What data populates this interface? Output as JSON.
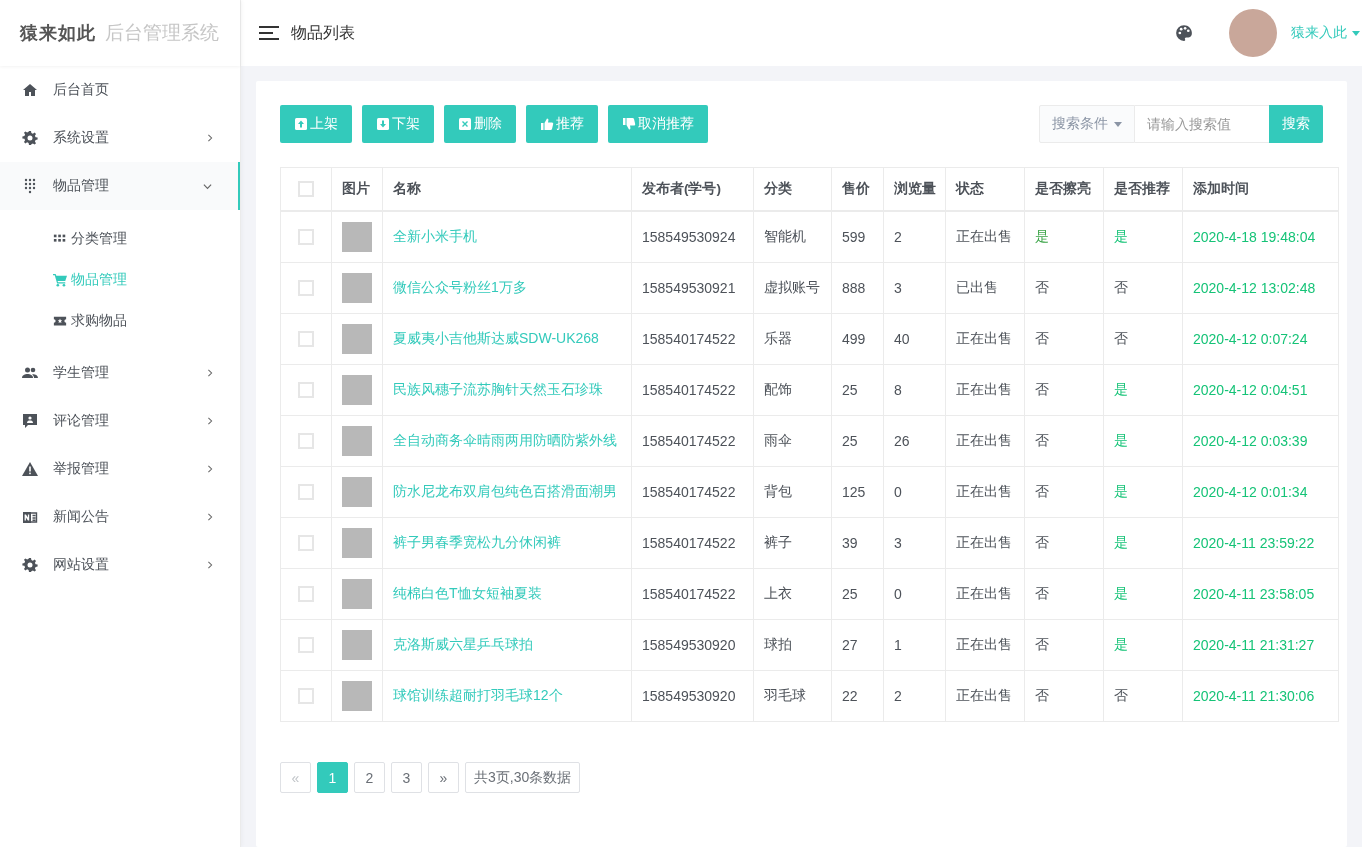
{
  "brand": {
    "logo": "猿来如此",
    "subtitle": "后台管理系统"
  },
  "header": {
    "title": "物品列表",
    "user_name": "猿来入此"
  },
  "sidebar": {
    "items": [
      {
        "label": "后台首页",
        "kind": "link"
      },
      {
        "label": "系统设置",
        "kind": "group",
        "expanded": false
      },
      {
        "label": "物品管理",
        "kind": "group",
        "expanded": true,
        "children": [
          {
            "label": "分类管理",
            "selected": false
          },
          {
            "label": "物品管理",
            "selected": true
          },
          {
            "label": "求购物品",
            "selected": false
          }
        ]
      },
      {
        "label": "学生管理",
        "kind": "group",
        "expanded": false
      },
      {
        "label": "评论管理",
        "kind": "group",
        "expanded": false
      },
      {
        "label": "举报管理",
        "kind": "group",
        "expanded": false
      },
      {
        "label": "新闻公告",
        "kind": "group",
        "expanded": false
      },
      {
        "label": "网站设置",
        "kind": "group",
        "expanded": false
      }
    ]
  },
  "toolbar": {
    "buttons": [
      "上架",
      "下架",
      "删除",
      "推荐",
      "取消推荐"
    ],
    "search": {
      "condition": "搜索条件",
      "placeholder": "请输入搜索值",
      "button": "搜索"
    }
  },
  "table": {
    "select_all": false,
    "columns": [
      "图片",
      "名称",
      "发布者(学号)",
      "分类",
      "售价",
      "浏览量",
      "状态",
      "是否擦亮",
      "是否推荐",
      "添加时间"
    ],
    "rows": [
      {
        "checked": false,
        "name": "全新小米手机",
        "publisher": "158549530924",
        "category": "智能机",
        "price": "599",
        "views": "2",
        "status": "正在出售",
        "sticky": {
          "text": "是",
          "on": true
        },
        "recommended": {
          "text": "是",
          "on": true
        },
        "added": "2020-4-18 19:48:04"
      },
      {
        "checked": false,
        "name": "微信公众号粉丝1万多",
        "publisher": "158549530921",
        "category": "虚拟账号",
        "price": "888",
        "views": "3",
        "status": "已出售",
        "sticky": {
          "text": "否",
          "on": false
        },
        "recommended": {
          "text": "否",
          "on": false
        },
        "added": "2020-4-12 13:02:48"
      },
      {
        "checked": false,
        "name": "夏威夷小吉他斯达威SDW-UK268",
        "publisher": "158540174522",
        "category": "乐器",
        "price": "499",
        "views": "40",
        "status": "正在出售",
        "sticky": {
          "text": "否",
          "on": false
        },
        "recommended": {
          "text": "否",
          "on": false
        },
        "added": "2020-4-12 0:07:24"
      },
      {
        "checked": false,
        "name": "民族风穗子流苏胸针天然玉石珍珠",
        "publisher": "158540174522",
        "category": "配饰",
        "price": "25",
        "views": "8",
        "status": "正在出售",
        "sticky": {
          "text": "否",
          "on": false
        },
        "recommended": {
          "text": "是",
          "on": true
        },
        "added": "2020-4-12 0:04:51"
      },
      {
        "checked": false,
        "name": "全自动商务伞晴雨两用防晒防紫外线",
        "publisher": "158540174522",
        "category": "雨伞",
        "price": "25",
        "views": "26",
        "status": "正在出售",
        "sticky": {
          "text": "否",
          "on": false
        },
        "recommended": {
          "text": "是",
          "on": true
        },
        "added": "2020-4-12 0:03:39"
      },
      {
        "checked": false,
        "name": "防水尼龙布双肩包纯色百搭滑面潮男",
        "publisher": "158540174522",
        "category": "背包",
        "price": "125",
        "views": "0",
        "status": "正在出售",
        "sticky": {
          "text": "否",
          "on": false
        },
        "recommended": {
          "text": "是",
          "on": true
        },
        "added": "2020-4-12 0:01:34"
      },
      {
        "checked": false,
        "name": "裤子男春季宽松九分休闲裤",
        "publisher": "158540174522",
        "category": "裤子",
        "price": "39",
        "views": "3",
        "status": "正在出售",
        "sticky": {
          "text": "否",
          "on": false
        },
        "recommended": {
          "text": "是",
          "on": true
        },
        "added": "2020-4-11 23:59:22"
      },
      {
        "checked": false,
        "name": "纯棉白色T恤女短袖夏装",
        "publisher": "158540174522",
        "category": "上衣",
        "price": "25",
        "views": "0",
        "status": "正在出售",
        "sticky": {
          "text": "否",
          "on": false
        },
        "recommended": {
          "text": "是",
          "on": true
        },
        "added": "2020-4-11 23:58:05"
      },
      {
        "checked": false,
        "name": "克洛斯威六星乒乓球拍",
        "publisher": "158549530920",
        "category": "球拍",
        "price": "27",
        "views": "1",
        "status": "正在出售",
        "sticky": {
          "text": "否",
          "on": false
        },
        "recommended": {
          "text": "是",
          "on": true
        },
        "added": "2020-4-11 21:31:27"
      },
      {
        "checked": false,
        "name": "球馆训练超耐打羽毛球12个",
        "publisher": "158549530920",
        "category": "羽毛球",
        "price": "22",
        "views": "2",
        "status": "正在出售",
        "sticky": {
          "text": "否",
          "on": false
        },
        "recommended": {
          "text": "否",
          "on": false
        },
        "added": "2020-4-11 21:30:06"
      }
    ]
  },
  "pagination": {
    "prev": "«",
    "prev_disabled": true,
    "pages": [
      {
        "label": "1",
        "selected": true
      },
      {
        "label": "2",
        "selected": false
      },
      {
        "label": "3",
        "selected": false
      }
    ],
    "next": "»",
    "summary": "共3页,30条数据"
  }
}
